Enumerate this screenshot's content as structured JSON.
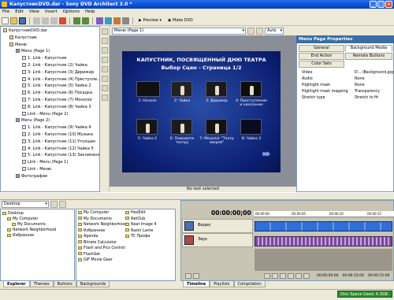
{
  "window": {
    "title": "КапустникDVD.dar - Sony DVD Architect 3.0 *"
  },
  "menu": [
    "File",
    "Edit",
    "View",
    "Insert",
    "Options",
    "Help"
  ],
  "toolbar": {
    "preview_label": "Preview",
    "make_dvd_label": "Make DVD"
  },
  "tree": {
    "items": [
      "КапустникDVD.dar",
      "Капустник",
      "Меню",
      "Menu (Page 1)",
      "1: Link - Капустник",
      "2: Link - Капустник (2) Чайка",
      "3: Link - Капустник (3) Дирижер",
      "4: Link - Капустник (4) Преступле...",
      "5: Link - Капустник (5) Чайка 2",
      "6: Link - Капустник (6) Посадка",
      "7: Link - Капустник (7) Монолог",
      "8: Link - Капустник (8) Чайка 3",
      "Link - Menu (Page 2)",
      "Menu (Page 2)",
      "1: Link - Капустник (9) Чайка 4",
      "2: Link - Капустник (10) Музыка",
      "3: Link - Капустник (11) Утолщен",
      "4: Link - Капустник (12) Чайка 5",
      "5: Link - Капустник (13) Заклинание",
      "Link - Menu (Page 1)",
      "Link - Меню",
      "Фотографии"
    ]
  },
  "editor": {
    "page_combo": "Меню (Page 1)",
    "zoom": "Auto",
    "status": "No text selected"
  },
  "menupage": {
    "title_line1": "КАПУСТНИК, ПОСВЯЩЕННЫЙ ДНЮ ТЕАТРА",
    "title_line2": "Выбор Сцен - Страница 1/2",
    "thumbs": [
      "1: Начало",
      "2: Чайка",
      "3: Дирижер",
      "4: Преступление и наказание",
      "5: Чайка 2",
      "6: Поможите театру",
      "7: Монолог \"Театр зверей\"",
      "8: Чайка 3"
    ]
  },
  "properties": {
    "title": "Menu Page Properties",
    "tabs": [
      "General",
      "Background Media",
      "End Action",
      "Remote Buttons",
      "Color Sets"
    ],
    "rows": [
      {
        "k": "Video",
        "v": "D:...\\Background.jpg"
      },
      {
        "k": "Audio",
        "v": "None"
      },
      {
        "k": "Highlight mask",
        "v": "None"
      },
      {
        "k": "Highlight mask mapping",
        "v": "Transparency"
      },
      {
        "k": "Stretch type",
        "v": "Stretch to fit"
      }
    ]
  },
  "explorer": {
    "path": "Desktop",
    "left_items": [
      "Desktop",
      "My Computer",
      "My Documents",
      "Network Neighborhood",
      "Избранное"
    ],
    "right_col1": [
      "My Computer",
      "My Documents",
      "Network Neighborhood",
      "Избранное",
      "Agenda",
      "Bitrate Calculator",
      "Flash and Pics Control",
      "FlashGet",
      "GIF Movie Gear"
    ],
    "right_col2": [
      "HexEdit",
      "NetOub",
      "Neat Image 4",
      "Razor Lame",
      "TC Профи"
    ],
    "tabs": [
      "Explorer",
      "Themes",
      "Buttons",
      "Backgrounds"
    ]
  },
  "timeline": {
    "timecode": "00:00:00;00",
    "ruler": [
      "00:00:00",
      "00:00:05",
      "00:00:10",
      "00:00:15"
    ],
    "tracks": [
      "Видео",
      "Звук"
    ],
    "end_times": [
      "00:00:00:00",
      "00:00:15:00",
      "00:00:15:00"
    ],
    "tabs": [
      "Timeline",
      "Playlists",
      "Compilation"
    ]
  },
  "status": {
    "disc_space": "Disc Space Used: 4.3GB"
  },
  "colors": {
    "accent": "#0a4fd6",
    "menu_bg": "#0b1f72",
    "disc_green": "#2e8b2e"
  }
}
